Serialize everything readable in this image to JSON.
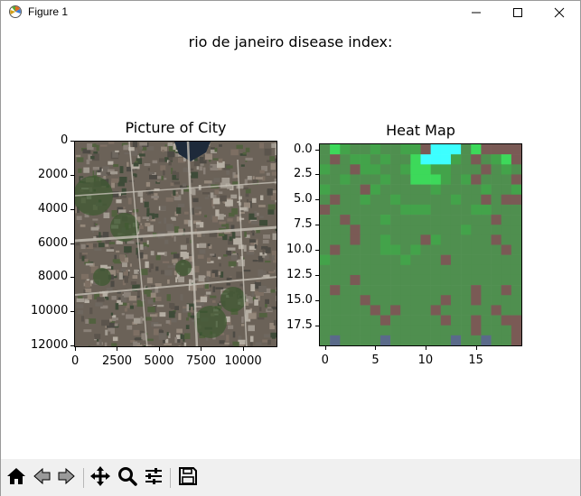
{
  "window": {
    "title": "Figure 1",
    "icons": [
      "matplotlib-logo-icon",
      "minimize-icon",
      "maximize-icon",
      "close-icon"
    ]
  },
  "figure": {
    "suptitle": "rio de janeiro disease index:",
    "left_axes": {
      "title": "Picture of City",
      "x_ticks": [
        "0",
        "2500",
        "5000",
        "7500",
        "10000"
      ],
      "y_ticks": [
        "0",
        "2000",
        "4000",
        "6000",
        "8000",
        "10000",
        "12000"
      ]
    },
    "right_axes": {
      "title": "Heat Map",
      "x_ticks": [
        "0",
        "5",
        "10",
        "15"
      ],
      "y_ticks": [
        "0.0",
        "2.5",
        "5.0",
        "7.5",
        "10.0",
        "12.5",
        "15.0",
        "17.5"
      ]
    }
  },
  "toolbar": {
    "tools": [
      "home-icon",
      "back-icon",
      "forward-icon",
      "pan-icon",
      "zoom-icon",
      "configure-subplots-icon",
      "save-icon"
    ]
  },
  "chart_data": {
    "type": "heatmap",
    "title": "Heat Map",
    "grid_size": [
      20,
      20
    ],
    "xlim": [
      -0.5,
      19.5
    ],
    "ylim": [
      19.5,
      -0.5
    ],
    "legend": "none",
    "grid": false,
    "colors": {
      "low": "#7a5a55",
      "mid": "#4f8f4f",
      "high": "#3dff5a",
      "peak": "#3dffff",
      "blue": "#5a6a8a"
    },
    "values": [
      [
        1,
        3,
        2,
        1,
        1,
        2,
        1,
        1,
        2,
        2,
        0,
        4,
        4,
        4,
        1,
        3,
        0,
        0,
        0,
        0
      ],
      [
        1,
        0,
        1,
        2,
        2,
        1,
        2,
        1,
        1,
        3,
        4,
        4,
        4,
        2,
        1,
        0,
        1,
        2,
        3,
        0
      ],
      [
        2,
        1,
        1,
        0,
        2,
        2,
        1,
        1,
        2,
        3,
        3,
        2,
        2,
        1,
        1,
        1,
        0,
        1,
        2,
        1
      ],
      [
        1,
        1,
        2,
        1,
        1,
        1,
        2,
        1,
        1,
        3,
        3,
        3,
        2,
        1,
        2,
        0,
        1,
        1,
        1,
        0
      ],
      [
        2,
        1,
        1,
        1,
        0,
        2,
        1,
        1,
        1,
        1,
        1,
        2,
        1,
        1,
        1,
        1,
        2,
        1,
        1,
        2
      ],
      [
        1,
        0,
        1,
        1,
        2,
        1,
        1,
        2,
        1,
        1,
        1,
        1,
        1,
        2,
        1,
        1,
        0,
        1,
        0,
        0
      ],
      [
        0,
        1,
        1,
        1,
        1,
        1,
        1,
        1,
        2,
        2,
        2,
        1,
        1,
        1,
        1,
        2,
        2,
        1,
        1,
        1
      ],
      [
        1,
        1,
        0,
        1,
        1,
        1,
        2,
        1,
        1,
        1,
        1,
        1,
        1,
        1,
        1,
        1,
        1,
        0,
        1,
        1
      ],
      [
        1,
        1,
        1,
        0,
        1,
        1,
        1,
        1,
        1,
        1,
        1,
        1,
        1,
        1,
        2,
        1,
        1,
        1,
        1,
        1
      ],
      [
        1,
        1,
        1,
        0,
        1,
        1,
        2,
        1,
        1,
        1,
        0,
        2,
        1,
        1,
        1,
        1,
        1,
        0,
        1,
        1
      ],
      [
        1,
        0,
        1,
        1,
        1,
        1,
        2,
        2,
        1,
        2,
        1,
        1,
        1,
        1,
        1,
        1,
        1,
        1,
        0,
        1
      ],
      [
        2,
        1,
        1,
        1,
        1,
        1,
        1,
        1,
        2,
        1,
        1,
        1,
        0,
        1,
        1,
        1,
        1,
        1,
        1,
        1
      ],
      [
        1,
        1,
        1,
        1,
        1,
        1,
        1,
        1,
        1,
        1,
        1,
        1,
        1,
        1,
        1,
        1,
        1,
        1,
        1,
        1
      ],
      [
        1,
        1,
        1,
        0,
        1,
        1,
        1,
        1,
        1,
        1,
        1,
        1,
        1,
        1,
        1,
        1,
        1,
        1,
        1,
        1
      ],
      [
        1,
        0,
        1,
        1,
        1,
        1,
        1,
        1,
        1,
        1,
        1,
        1,
        1,
        1,
        1,
        0,
        1,
        1,
        0,
        1
      ],
      [
        1,
        1,
        1,
        1,
        0,
        1,
        1,
        1,
        1,
        1,
        1,
        1,
        0,
        1,
        1,
        0,
        1,
        1,
        1,
        1
      ],
      [
        1,
        1,
        1,
        1,
        1,
        0,
        1,
        0,
        1,
        1,
        1,
        0,
        1,
        1,
        1,
        1,
        1,
        0,
        1,
        1
      ],
      [
        1,
        1,
        1,
        1,
        1,
        1,
        0,
        1,
        1,
        1,
        1,
        1,
        0,
        1,
        1,
        0,
        1,
        1,
        0,
        0
      ],
      [
        1,
        1,
        1,
        1,
        1,
        1,
        1,
        1,
        1,
        1,
        1,
        1,
        1,
        1,
        1,
        0,
        1,
        1,
        1,
        0
      ],
      [
        1,
        5,
        1,
        1,
        1,
        1,
        5,
        1,
        1,
        1,
        1,
        1,
        1,
        5,
        1,
        1,
        5,
        1,
        1,
        0
      ]
    ]
  }
}
